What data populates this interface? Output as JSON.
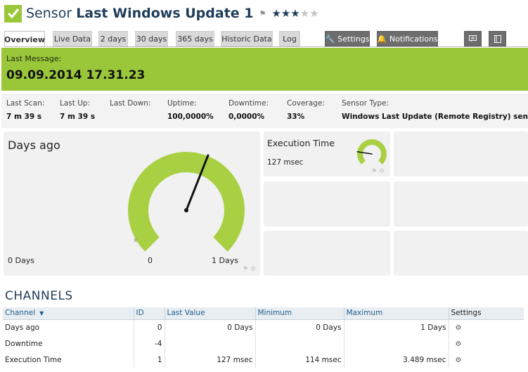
{
  "header": {
    "title_prefix": "Sensor",
    "title_name": "Last Windows Update 1",
    "priority_stars_filled": 3,
    "priority_stars_total": 5,
    "status_color": "#9ac73a"
  },
  "tabs": [
    {
      "label": "Overview",
      "active": true
    },
    {
      "label": "Live Data"
    },
    {
      "label": "2 days"
    },
    {
      "label": "30 days"
    },
    {
      "label": "365 days"
    },
    {
      "label": "Historic Data"
    },
    {
      "label": "Log"
    },
    {
      "label": "Settings",
      "icon": "wrench-icon"
    },
    {
      "label": "Notifications",
      "icon": "bell-icon"
    }
  ],
  "toolbar_icons": [
    "comment-icon",
    "notes-icon"
  ],
  "last_message": {
    "label": "Last Message:",
    "value": "09.09.2014 17.31.23"
  },
  "stats": [
    {
      "label": "Last Scan:",
      "value": "7 m 39 s"
    },
    {
      "label": "Last Up:",
      "value": "7 m 39 s"
    },
    {
      "label": "Last Down:",
      "value": ""
    },
    {
      "label": "Uptime:",
      "value": "100,0000%"
    },
    {
      "label": "Downtime:",
      "value": "0,0000%"
    },
    {
      "label": "Coverage:",
      "value": "33%"
    },
    {
      "label": "Sensor Type:",
      "value": "Windows Last Update (Remote Registry) sensor"
    }
  ],
  "gauges": {
    "days_ago": {
      "title": "Days ago",
      "min_label": "0 Days",
      "value_label": "0",
      "max_label": "1 Days",
      "min_marker": "x",
      "value_fraction": 0.58
    },
    "execution_time": {
      "title": "Execution Time",
      "value_label": "127 msec",
      "value_fraction": 0.2
    }
  },
  "channels": {
    "title": "CHANNELS",
    "columns": [
      "Channel",
      "ID",
      "Last Value",
      "Minimum",
      "Maximum",
      "Settings"
    ],
    "rows": [
      {
        "channel": "Days ago",
        "id": "0",
        "last": "0 Days",
        "min": "0 Days",
        "max": "1 Days"
      },
      {
        "channel": "Downtime",
        "id": "-4",
        "last": "",
        "min": "",
        "max": ""
      },
      {
        "channel": "Execution Time",
        "id": "1",
        "last": "127 msec",
        "min": "114 msec",
        "max": "3.489 msec"
      }
    ]
  }
}
